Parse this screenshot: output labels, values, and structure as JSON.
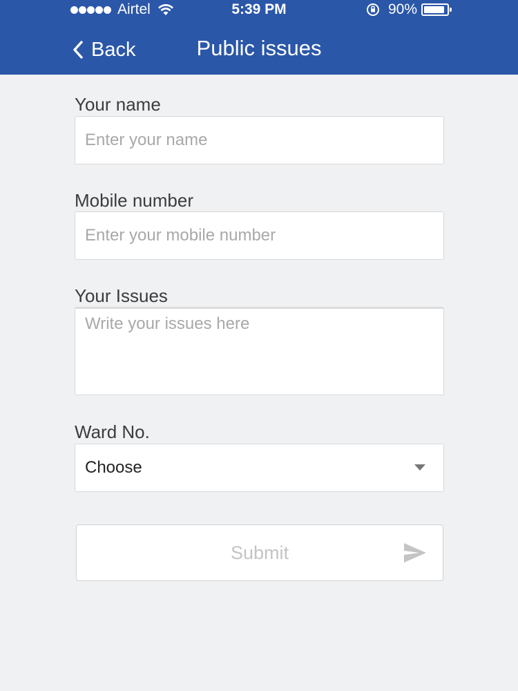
{
  "status_bar": {
    "carrier": "Airtel",
    "time": "5:39 PM",
    "battery_percent": "90%",
    "battery_level": 0.9,
    "signal_bars": 5,
    "icons": [
      "wifi-icon",
      "orientation-lock-icon",
      "battery-icon"
    ]
  },
  "nav": {
    "back_label": "Back",
    "title": "Public issues",
    "accent_color": "#2b57a8"
  },
  "form": {
    "name": {
      "label": "Your name",
      "placeholder": "Enter your name",
      "value": ""
    },
    "mobile": {
      "label": "Mobile number",
      "placeholder": "Enter your mobile number",
      "value": ""
    },
    "issues": {
      "label": "Your Issues",
      "placeholder": "Write your issues here",
      "value": ""
    },
    "ward": {
      "label": "Ward No.",
      "selected": "Choose"
    },
    "submit_label": "Submit"
  }
}
